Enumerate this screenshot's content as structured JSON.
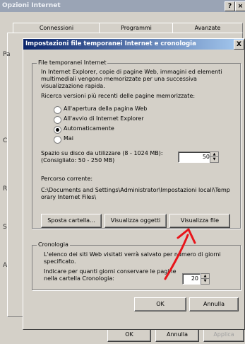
{
  "outer": {
    "title": "Opzioni Internet",
    "help_button": "?",
    "tabs": [
      "Connessioni",
      "Programmi",
      "Avanzate"
    ],
    "side_letters": [
      "Pa",
      "C",
      "R",
      "S",
      "A"
    ],
    "buttons": {
      "ok": "OK",
      "cancel": "Annulla",
      "apply": "Applica"
    }
  },
  "dialog": {
    "title": "Impostazioni file temporanei Internet e cronologia",
    "close_button": "X",
    "temp_files": {
      "group_title": "File temporanei Internet",
      "description": "In Internet Explorer, copie di pagine Web, immagini ed elementi multimediali vengono memorizzate per una successiva visualizzazione rapida.",
      "check_label": "Ricerca versioni più recenti delle pagine memorizzate:",
      "options": [
        "All'apertura della pagina Web",
        "All'avvio di Internet Explorer",
        "Automaticamente",
        "Mai"
      ],
      "selected_option": "Automaticamente",
      "space_label": "Spazio su disco da utilizzare (8 - 1024 MB):",
      "recommended": "(Consigliato: 50 - 250 MB)",
      "space_value": "50",
      "current_path_label": "Percorso corrente:",
      "current_path": "C:\\Documents and Settings\\Administrator\\Impostazioni locali\\Temporary Internet Files\\",
      "btn_move": "Sposta cartella...",
      "btn_view_objects": "Visualizza oggetti",
      "btn_view_files": "Visualizza file"
    },
    "history": {
      "group_title": "Cronologia",
      "description": "L'elenco dei siti Web visitati verrà salvato per numero di giorni specificato.",
      "days_label": "Indicare per quanti giorni conservare le pagine nella cartella Cronologia:",
      "days_value": "20"
    },
    "buttons": {
      "ok": "OK",
      "cancel": "Annulla"
    }
  },
  "colors": {
    "annotation_arrow": "#e8141a",
    "dialog_title_bg": "#0a246a",
    "face": "#d4d0c8"
  }
}
